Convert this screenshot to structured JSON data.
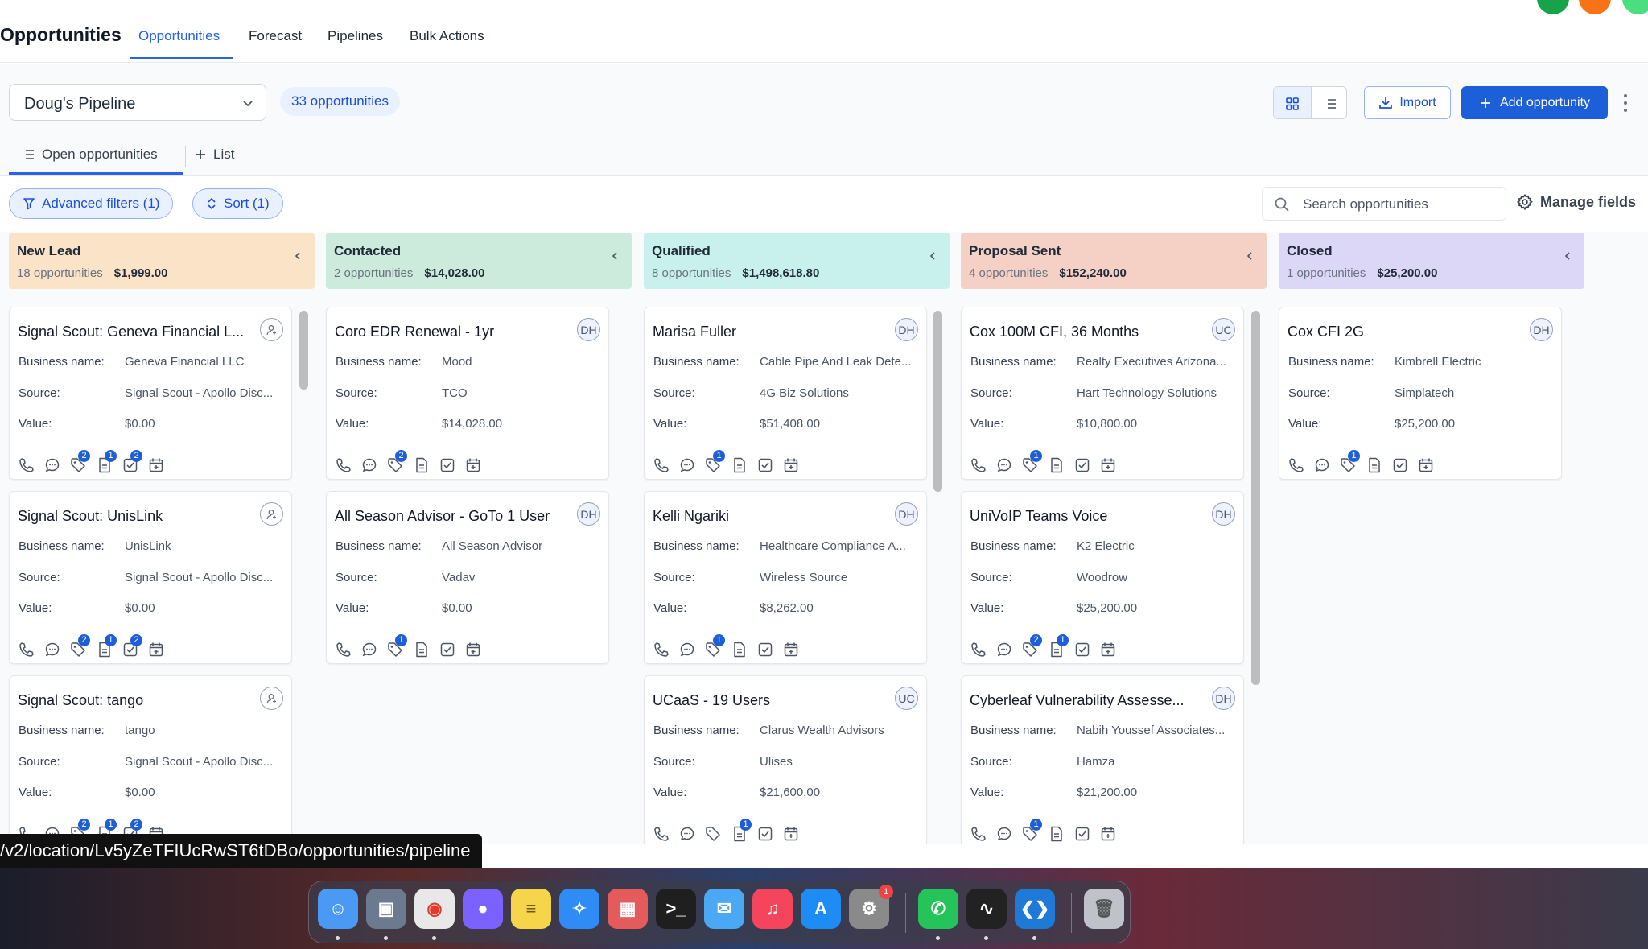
{
  "header": {
    "title": "Opportunities",
    "tabs": [
      {
        "label": "Opportunities",
        "active": true
      },
      {
        "label": "Forecast",
        "active": false
      },
      {
        "label": "Pipelines",
        "active": false
      },
      {
        "label": "Bulk Actions",
        "active": false
      }
    ],
    "avatar_colors": [
      "#16a34a",
      "#f97316",
      "#4ade80"
    ]
  },
  "toolbar": {
    "pipeline": "Doug's Pipeline",
    "count": "33 opportunities",
    "import_label": "Import",
    "add_label": "Add opportunity",
    "accent": "#1d5fd8"
  },
  "views": {
    "open_label": "Open opportunities",
    "add_list_label": "List"
  },
  "filters": {
    "advanced_label": "Advanced filters (1)",
    "sort_label": "Sort (1)",
    "search_placeholder": "Search opportunities",
    "manage_fields_label": "Manage fields"
  },
  "field_labels": {
    "business": "Business name:",
    "source": "Source:",
    "value": "Value:"
  },
  "columns": [
    {
      "name": "New Lead",
      "count": "18 opportunities",
      "total": "$1,999.00",
      "color": "#fae3c7",
      "cards": [
        {
          "title": "Signal Scout: Geneva Financial L...",
          "avatar": "",
          "business": "Geneva Financial LLC",
          "source": "Signal Scout - Apollo Disc...",
          "value": "$0.00",
          "badges": [
            null,
            null,
            "2",
            "1",
            "2",
            null
          ]
        },
        {
          "title": "Signal Scout: UnisLink",
          "avatar": "",
          "business": "UnisLink",
          "source": "Signal Scout - Apollo Disc...",
          "value": "$0.00",
          "badges": [
            null,
            null,
            "2",
            "1",
            "2",
            null
          ]
        },
        {
          "title": "Signal Scout: tango",
          "avatar": "",
          "business": "tango",
          "source": "Signal Scout - Apollo Disc...",
          "value": "$0.00",
          "badges": [
            null,
            null,
            "2",
            "1",
            "2",
            null
          ]
        }
      ]
    },
    {
      "name": "Contacted",
      "count": "2 opportunities",
      "total": "$14,028.00",
      "color": "#cdebdc",
      "cards": [
        {
          "title": "Coro EDR Renewal - 1yr",
          "avatar": "DH",
          "business": "Mood",
          "source": "TCO",
          "value": "$14,028.00",
          "badges": [
            null,
            null,
            "2",
            null,
            null,
            null
          ]
        },
        {
          "title": "All Season Advisor - GoTo 1 User",
          "avatar": "DH",
          "business": "All Season Advisor",
          "source": "Vadav",
          "value": "$0.00",
          "badges": [
            null,
            null,
            "1",
            null,
            null,
            null
          ]
        }
      ]
    },
    {
      "name": "Qualified",
      "count": "8 opportunities",
      "total": "$1,498,618.80",
      "color": "#c8f0ec",
      "cards": [
        {
          "title": "Marisa Fuller",
          "avatar": "DH",
          "business": "Cable Pipe And Leak Dete...",
          "source": "4G Biz Solutions",
          "value": "$51,408.00",
          "badges": [
            null,
            null,
            "1",
            null,
            null,
            null
          ]
        },
        {
          "title": "Kelli Ngariki",
          "avatar": "DH",
          "business": "Healthcare Compliance A...",
          "source": "Wireless Source",
          "value": "$8,262.00",
          "badges": [
            null,
            null,
            "1",
            null,
            null,
            null
          ]
        },
        {
          "title": "UCaaS - 19 Users",
          "avatar": "UC",
          "business": "Clarus Wealth Advisors",
          "source": "Ulises",
          "value": "$21,600.00",
          "badges": [
            null,
            null,
            null,
            "1",
            null,
            null
          ]
        }
      ]
    },
    {
      "name": "Proposal Sent",
      "count": "4 opportunities",
      "total": "$152,240.00",
      "color": "#f5d0c4",
      "cards": [
        {
          "title": "Cox 100M CFI, 36 Months",
          "avatar": "UC",
          "business": "Realty Executives Arizona...",
          "source": "Hart Technology Solutions",
          "value": "$10,800.00",
          "badges": [
            null,
            null,
            "1",
            null,
            null,
            null
          ]
        },
        {
          "title": "UniVoIP Teams Voice",
          "avatar": "DH",
          "business": "K2 Electric",
          "source": "Woodrow",
          "value": "$25,200.00",
          "badges": [
            null,
            null,
            "2",
            "1",
            null,
            null
          ]
        },
        {
          "title": "Cyberleaf Vulnerability Assesse...",
          "avatar": "DH",
          "business": "Nabih Youssef Associates...",
          "source": "Hamza",
          "value": "$21,200.00",
          "badges": [
            null,
            null,
            "1",
            null,
            null,
            null
          ]
        }
      ]
    },
    {
      "name": "Closed",
      "count": "1 opportunities",
      "total": "$25,200.00",
      "color": "#dcd6f7",
      "cards": [
        {
          "title": "Cox CFI 2G",
          "avatar": "DH",
          "business": "Kimbrell Electric",
          "source": "Simplatech",
          "value": "$25,200.00",
          "badges": [
            null,
            null,
            "1",
            null,
            null,
            null
          ]
        }
      ]
    }
  ],
  "status_url": "/v2/location/Lv5yZeTFIUcRwST6tDBo/opportunities/pipeline",
  "dock": {
    "apps": [
      {
        "name": "finder",
        "color": "#4a9af5",
        "glyph": "☺"
      },
      {
        "name": "preview",
        "color": "#6b7a8f",
        "glyph": "▣"
      },
      {
        "name": "chrome",
        "color": "#e8e8e8",
        "glyph": "◉"
      },
      {
        "name": "messenger",
        "color": "#7b61ff",
        "glyph": "●"
      },
      {
        "name": "notes",
        "color": "#f7d54a",
        "glyph": "≡"
      },
      {
        "name": "safari",
        "color": "#2f8cf7",
        "glyph": "✧"
      },
      {
        "name": "launchpad",
        "color": "#e55a5a",
        "glyph": "▦"
      },
      {
        "name": "terminal",
        "color": "#1f1f1f",
        "glyph": ">_"
      },
      {
        "name": "mail",
        "color": "#4aa8f5",
        "glyph": "✉"
      },
      {
        "name": "music",
        "color": "#f5455c",
        "glyph": "♫"
      },
      {
        "name": "app-store",
        "color": "#1e8cf5",
        "glyph": "A"
      },
      {
        "name": "system-settings",
        "color": "#8a8a8a",
        "glyph": "⚙",
        "badge": "1"
      },
      {
        "name": "whatsapp",
        "color": "#25c45a",
        "glyph": "✆"
      },
      {
        "name": "activity-monitor",
        "color": "#222",
        "glyph": "∿"
      },
      {
        "name": "vscode",
        "color": "#1e7ad6",
        "glyph": "❮❯"
      },
      {
        "name": "trash",
        "color": "#bfc3c9",
        "glyph": "🗑"
      }
    ]
  }
}
